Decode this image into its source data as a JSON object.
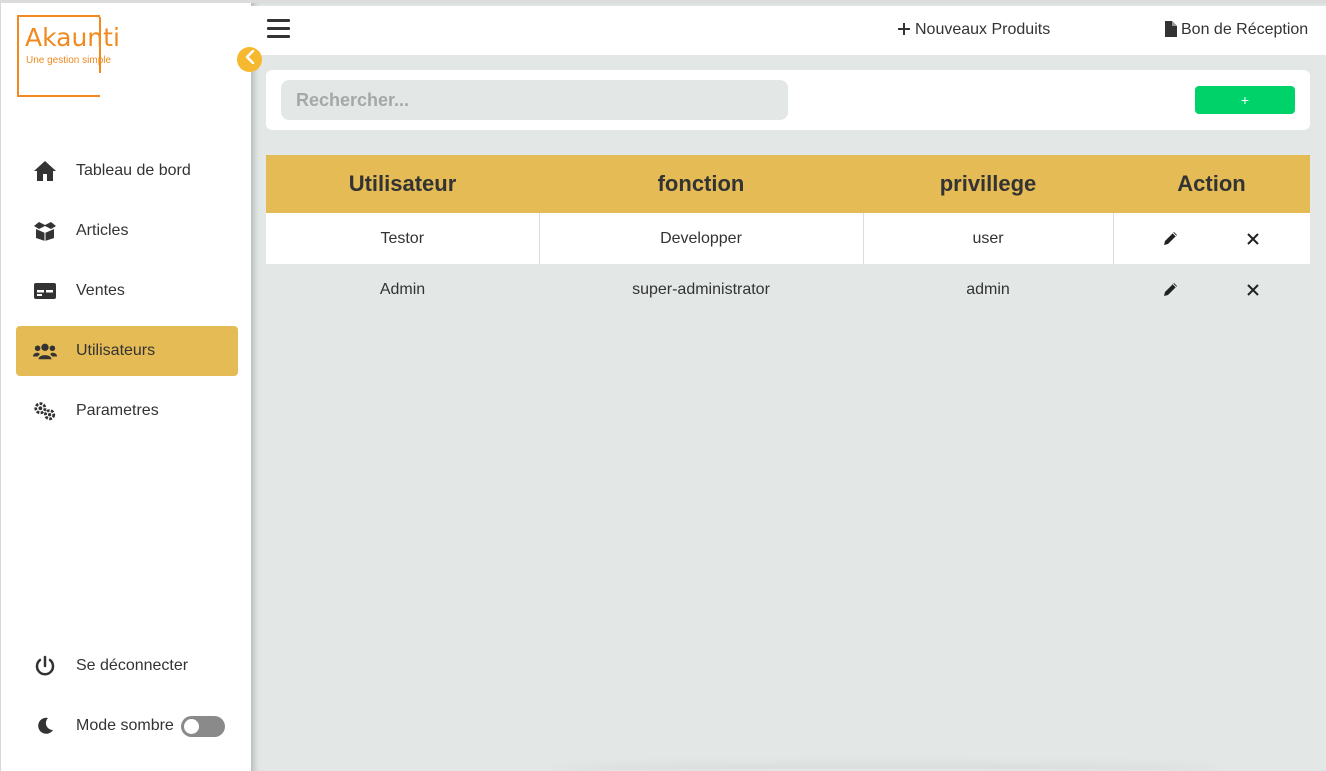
{
  "brand": {
    "name": "Akaunti",
    "tagline": "Une gestion simple",
    "color": "#f08a1f"
  },
  "sidebar": {
    "items": [
      {
        "label": "Tableau de bord",
        "icon": "home-icon",
        "active": false
      },
      {
        "label": "Articles",
        "icon": "box-icon",
        "active": false
      },
      {
        "label": "Ventes",
        "icon": "card-icon",
        "active": false
      },
      {
        "label": "Utilisateurs",
        "icon": "users-icon",
        "active": true
      },
      {
        "label": "Parametres",
        "icon": "gears-icon",
        "active": false
      }
    ],
    "bottom": [
      {
        "label": "Se déconnecter",
        "icon": "power-icon"
      },
      {
        "label": "Mode sombre",
        "icon": "moon-icon",
        "toggle": false
      }
    ],
    "active_color": "#e4bb55"
  },
  "topbar": {
    "new_products": "Nouveaux Produits",
    "receipt": "Bon de Réception"
  },
  "search": {
    "placeholder": "Rechercher...",
    "value": ""
  },
  "add_button": {
    "label": "+",
    "color": "#00d26a"
  },
  "table": {
    "headers": [
      "Utilisateur",
      "fonction",
      "privillege",
      "Action"
    ],
    "rows": [
      {
        "user": "Testor",
        "function": "Developper",
        "privilege": "user"
      },
      {
        "user": "Admin",
        "function": "super-administrator",
        "privilege": "admin"
      }
    ],
    "action_icons": [
      "pencil-icon",
      "close-icon"
    ]
  }
}
